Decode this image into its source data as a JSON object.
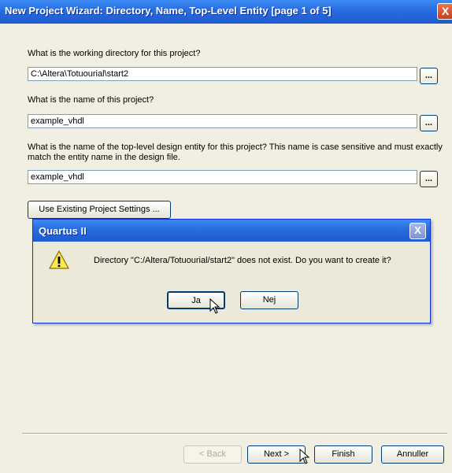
{
  "window": {
    "title": "New Project Wizard: Directory, Name, Top-Level Entity [page 1 of 5]",
    "close_label": "X"
  },
  "form": {
    "directory_question": "What is the working directory for this project?",
    "directory_value": "C:\\Altera\\Totuourial\\start2",
    "name_question": "What is the name of this project?",
    "name_value": "example_vhdl",
    "entity_question": "What is the name of the top-level design entity for this project? This name is case sensitive and must exactly match the entity name in the design file.",
    "entity_value": "example_vhdl",
    "browse_label": "...",
    "use_existing_label": "Use Existing Project Settings ..."
  },
  "dialog": {
    "title": "Quartus II",
    "message": "Directory \"C:/Altera/Totuourial/start2\" does not exist. Do you want to create it?",
    "yes_label": "Ja",
    "no_label": "Nej",
    "close_label": "X",
    "icon": "warning-icon"
  },
  "footer": {
    "back_label": "< Back",
    "next_label": "Next >",
    "finish_label": "Finish",
    "cancel_label": "Annuller"
  }
}
